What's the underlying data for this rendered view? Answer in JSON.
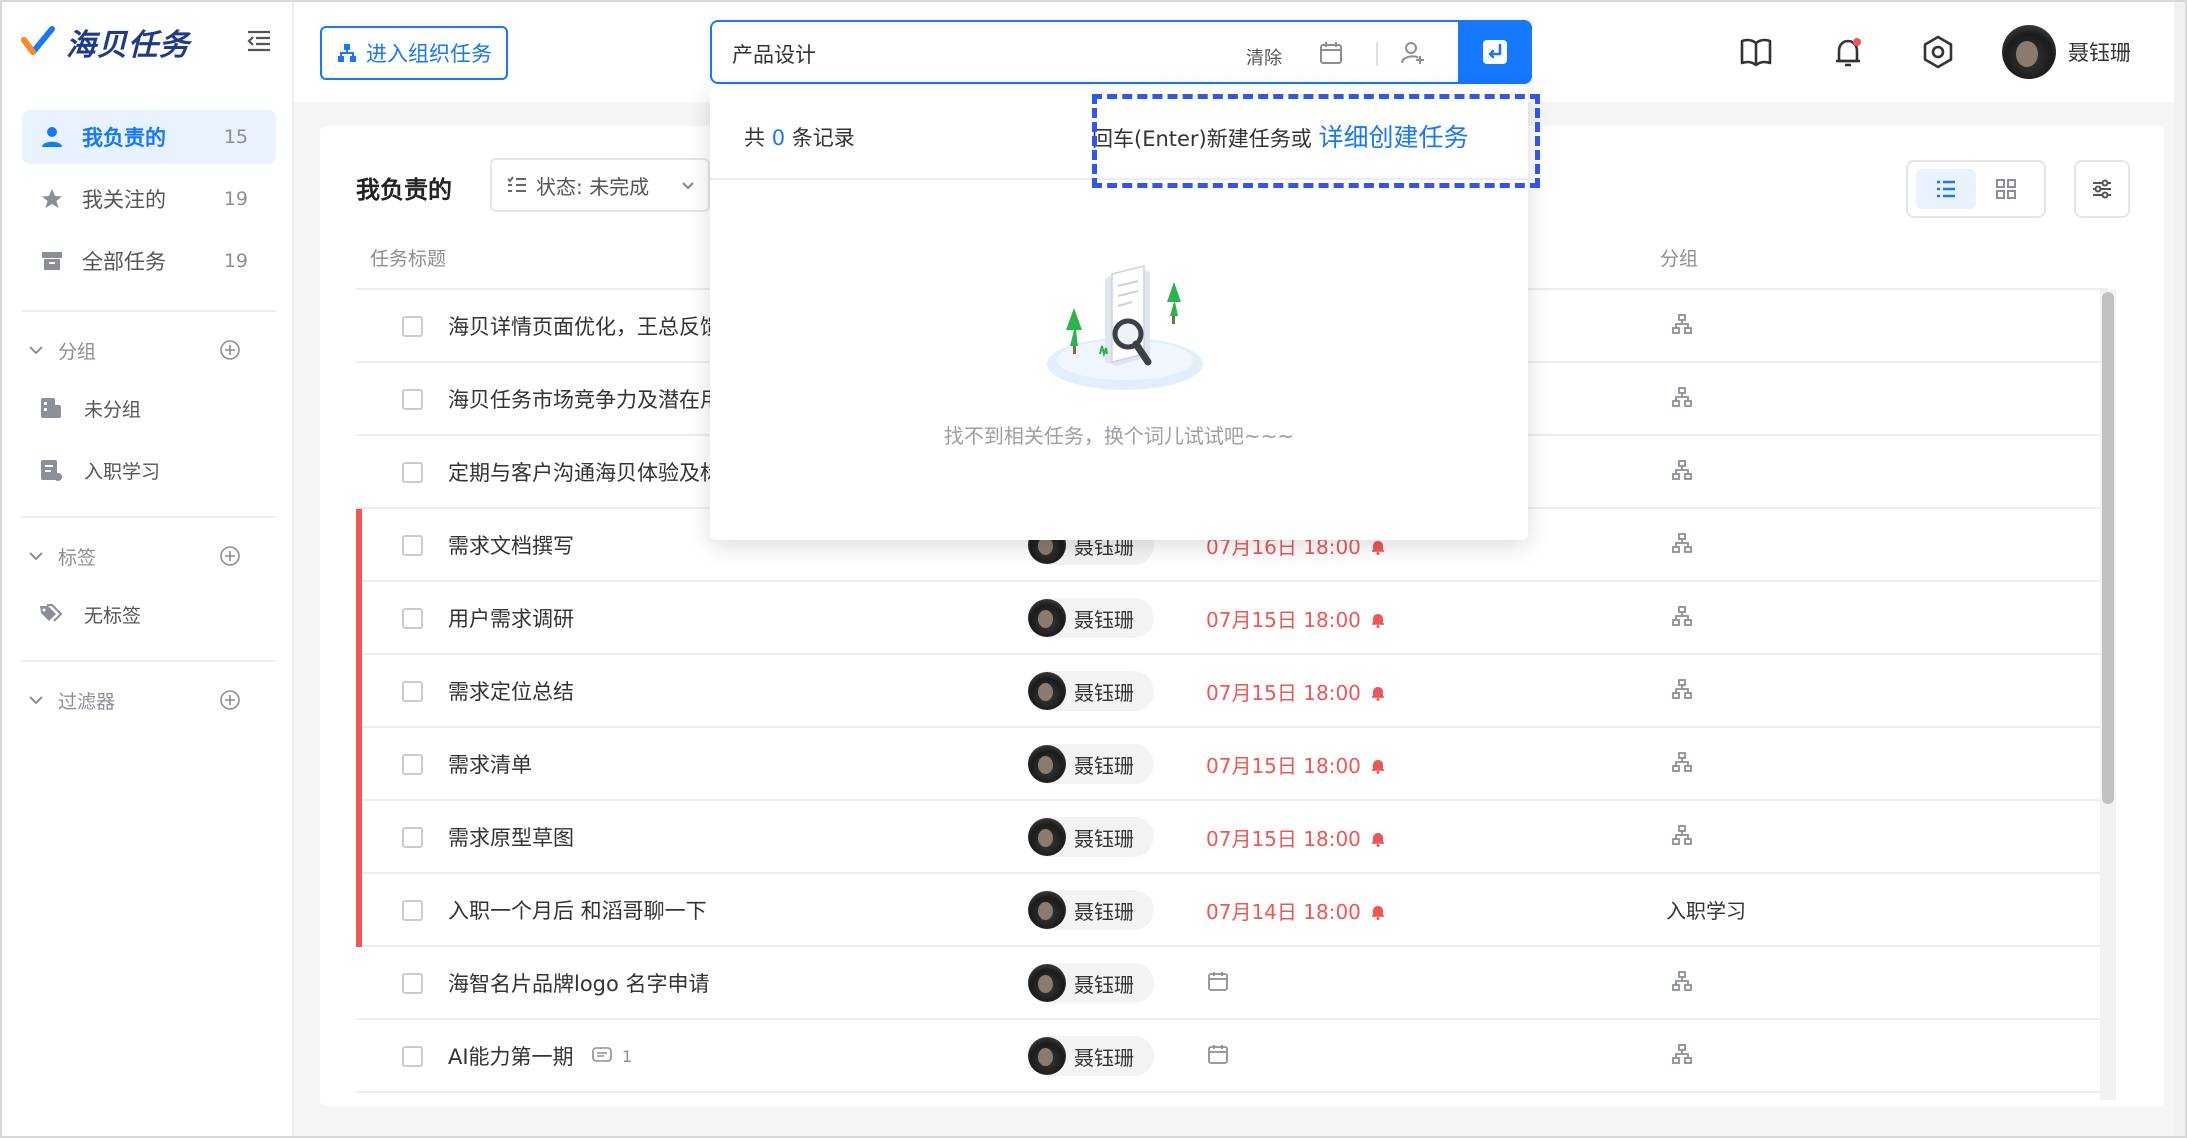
{
  "app": {
    "name": "海贝任务"
  },
  "sidebar": {
    "nav": [
      {
        "label": "我负责的",
        "count": "15"
      },
      {
        "label": "我关注的",
        "count": "19"
      },
      {
        "label": "全部任务",
        "count": "19"
      }
    ],
    "sections": {
      "groups": {
        "label": "分组",
        "items": [
          "未分组",
          "入职学习"
        ]
      },
      "tags": {
        "label": "标签",
        "items": [
          "无标签"
        ]
      },
      "filters": {
        "label": "过滤器"
      }
    }
  },
  "header": {
    "org_button": "进入组织任务",
    "search": {
      "value": "产品设计",
      "clear": "清除"
    },
    "user_name": "聂钰珊"
  },
  "main": {
    "title": "我负责的",
    "status_filter": "状态: 未完成",
    "columns": {
      "title": "任务标题",
      "group": "分组"
    },
    "rows": [
      {
        "title": "海贝详情页面优化，王总反馈",
        "owner": "",
        "due": "",
        "group": ""
      },
      {
        "title": "海贝任务市场竞争力及潜在用",
        "owner": "",
        "due": "",
        "group": ""
      },
      {
        "title": "定期与客户沟通海贝体验及标",
        "owner": "",
        "due": "",
        "group": ""
      },
      {
        "title": "需求文档撰写",
        "owner": "聂钰珊",
        "due": "07月16日 18:00",
        "group": ""
      },
      {
        "title": "用户需求调研",
        "owner": "聂钰珊",
        "due": "07月15日 18:00",
        "group": ""
      },
      {
        "title": "需求定位总结",
        "owner": "聂钰珊",
        "due": "07月15日 18:00",
        "group": ""
      },
      {
        "title": "需求清单",
        "owner": "聂钰珊",
        "due": "07月15日 18:00",
        "group": ""
      },
      {
        "title": "需求原型草图",
        "owner": "聂钰珊",
        "due": "07月15日 18:00",
        "group": ""
      },
      {
        "title": "入职一个月后 和滔哥聊一下",
        "owner": "聂钰珊",
        "due": "07月14日 18:00",
        "group": "入职学习"
      },
      {
        "title": "海智名片品牌logo 名字申请",
        "owner": "聂钰珊",
        "due": "",
        "group": ""
      },
      {
        "title": "AI能力第一期",
        "owner": "聂钰珊",
        "due": "",
        "group": "",
        "comments": "1"
      }
    ]
  },
  "dropdown": {
    "count_prefix": "共",
    "count": "0",
    "count_suffix": "条记录",
    "create_hint": "回车(Enter)新建任务或",
    "create_link": "详细创建任务",
    "empty_text": "找不到相关任务，换个词儿试试吧~~~"
  },
  "colors": {
    "primary": "#1677ff",
    "overdue": "#f25555",
    "highlight": "#3355ee"
  }
}
